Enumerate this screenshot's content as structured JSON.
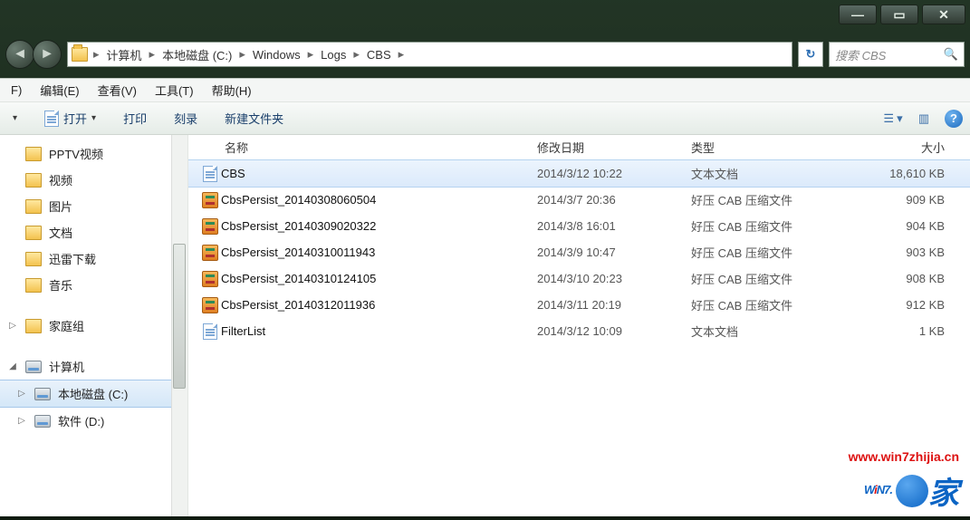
{
  "window": {
    "breadcrumb": [
      "计算机",
      "本地磁盘 (C:)",
      "Windows",
      "Logs",
      "CBS"
    ],
    "search_placeholder": "搜索 CBS"
  },
  "menubar": {
    "file_suffix": "F)",
    "items": [
      "编辑(E)",
      "查看(V)",
      "工具(T)",
      "帮助(H)"
    ]
  },
  "toolbar": {
    "open": "打开",
    "print": "打印",
    "burn": "刻录",
    "newfolder": "新建文件夹"
  },
  "nav": {
    "items": [
      {
        "label": "PPTV视频",
        "icon": "svc"
      },
      {
        "label": "视频",
        "icon": "svc"
      },
      {
        "label": "图片",
        "icon": "svc"
      },
      {
        "label": "文档",
        "icon": "svc"
      },
      {
        "label": "迅雷下载",
        "icon": "svc"
      },
      {
        "label": "音乐",
        "icon": "svc"
      }
    ],
    "homegroup": "家庭组",
    "computer": "计算机",
    "drives": [
      {
        "label": "本地磁盘 (C:)",
        "selected": true
      },
      {
        "label": "软件 (D:)",
        "selected": false
      }
    ]
  },
  "columns": {
    "name": "名称",
    "date": "修改日期",
    "type": "类型",
    "size": "大小"
  },
  "files": [
    {
      "name": "CBS",
      "date": "2014/3/12 10:22",
      "type": "文本文档",
      "size": "18,610 KB",
      "icon": "doc",
      "selected": true
    },
    {
      "name": "CbsPersist_20140308060504",
      "date": "2014/3/7 20:36",
      "type": "好压 CAB 压缩文件",
      "size": "909 KB",
      "icon": "cab"
    },
    {
      "name": "CbsPersist_20140309020322",
      "date": "2014/3/8 16:01",
      "type": "好压 CAB 压缩文件",
      "size": "904 KB",
      "icon": "cab"
    },
    {
      "name": "CbsPersist_20140310011943",
      "date": "2014/3/9 10:47",
      "type": "好压 CAB 压缩文件",
      "size": "903 KB",
      "icon": "cab"
    },
    {
      "name": "CbsPersist_20140310124105",
      "date": "2014/3/10 20:23",
      "type": "好压 CAB 压缩文件",
      "size": "908 KB",
      "icon": "cab"
    },
    {
      "name": "CbsPersist_20140312011936",
      "date": "2014/3/11 20:19",
      "type": "好压 CAB 压缩文件",
      "size": "912 KB",
      "icon": "cab"
    },
    {
      "name": "FilterList",
      "date": "2014/3/12 10:09",
      "type": "文本文档",
      "size": "1 KB",
      "icon": "doc"
    }
  ],
  "watermark": {
    "url": "www.win7zhijia.cn",
    "brand_left": "W",
    "brand_i": "i",
    "brand_rest": "N7.",
    "brand_suffix": "家"
  }
}
